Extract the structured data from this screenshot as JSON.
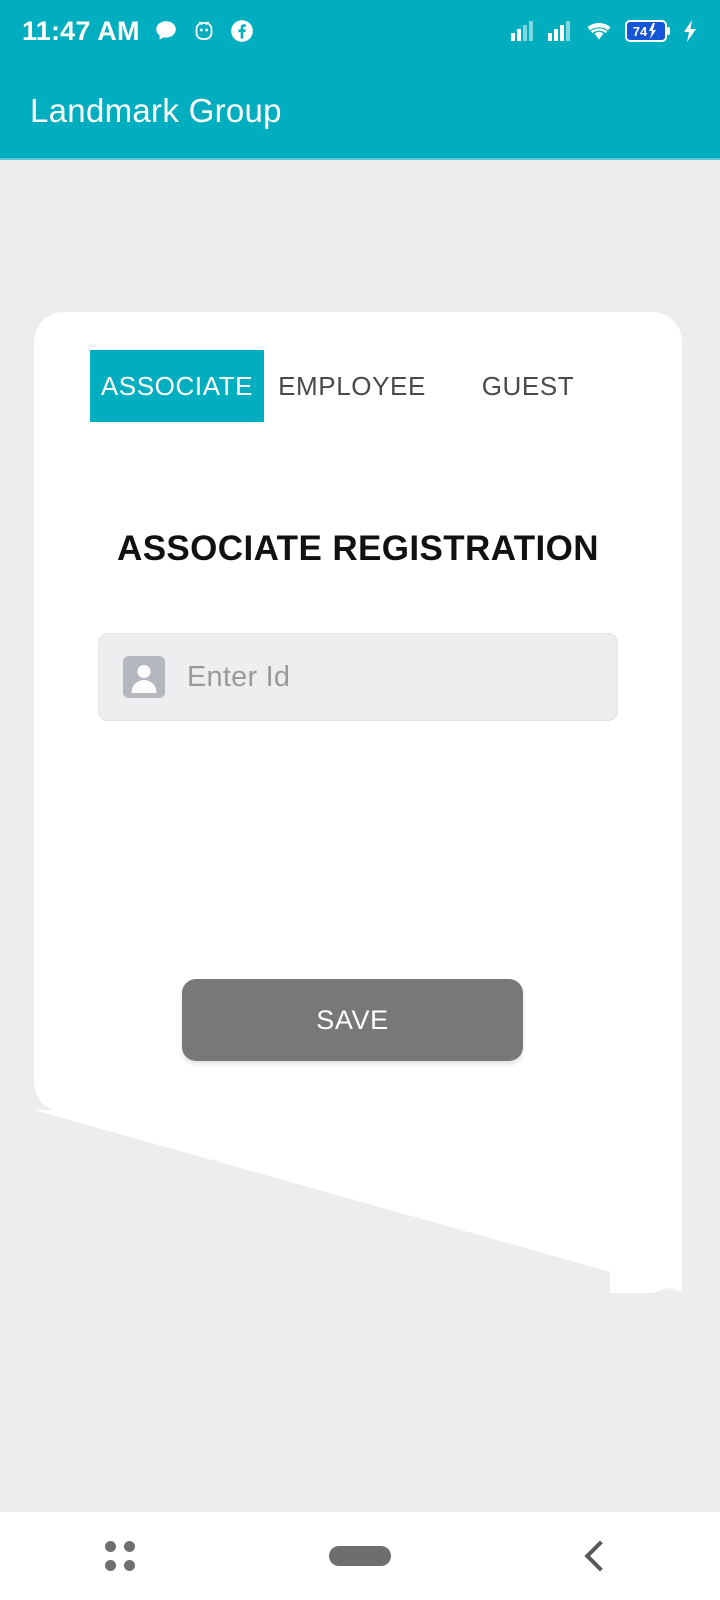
{
  "status_bar": {
    "time": "11:47 AM",
    "left_icons": [
      "chat-bubble-icon",
      "android-robot-icon",
      "facebook-icon"
    ],
    "right_icons": [
      "signal-bars-sim1-icon",
      "signal-bars-sim2-icon",
      "wifi-icon",
      "battery-icon",
      "charging-bolt-icon"
    ],
    "battery_level": "74",
    "background_color": "#00AEBF"
  },
  "app_bar": {
    "title": "Landmark Group",
    "background_color": "#00AEBF",
    "text_color": "#FFFFFF"
  },
  "card": {
    "tabs": [
      {
        "label": "ASSOCIATE",
        "selected": true
      },
      {
        "label": "EMPLOYEE",
        "selected": false
      },
      {
        "label": "GUEST",
        "selected": false
      }
    ],
    "heading": "ASSOCIATE REGISTRATION",
    "form": {
      "id_field": {
        "placeholder": "Enter Id",
        "value": "",
        "icon": "account-person-icon"
      }
    },
    "save_button": {
      "label": "SAVE",
      "enabled": false,
      "color": "#787878"
    },
    "background_color": "#FFFFFF"
  },
  "nav_bar": {
    "items": [
      {
        "name": "recents",
        "icon": "grid-dots-icon"
      },
      {
        "name": "home",
        "icon": "home-pill-icon"
      },
      {
        "name": "back",
        "icon": "chevron-left-icon"
      }
    ],
    "background_color": "#FFFFFF"
  },
  "theme": {
    "accent": "#00AEBF",
    "page_background": "#EDEDED",
    "heading_color": "#111111",
    "placeholder_color": "#9A9A9E"
  }
}
